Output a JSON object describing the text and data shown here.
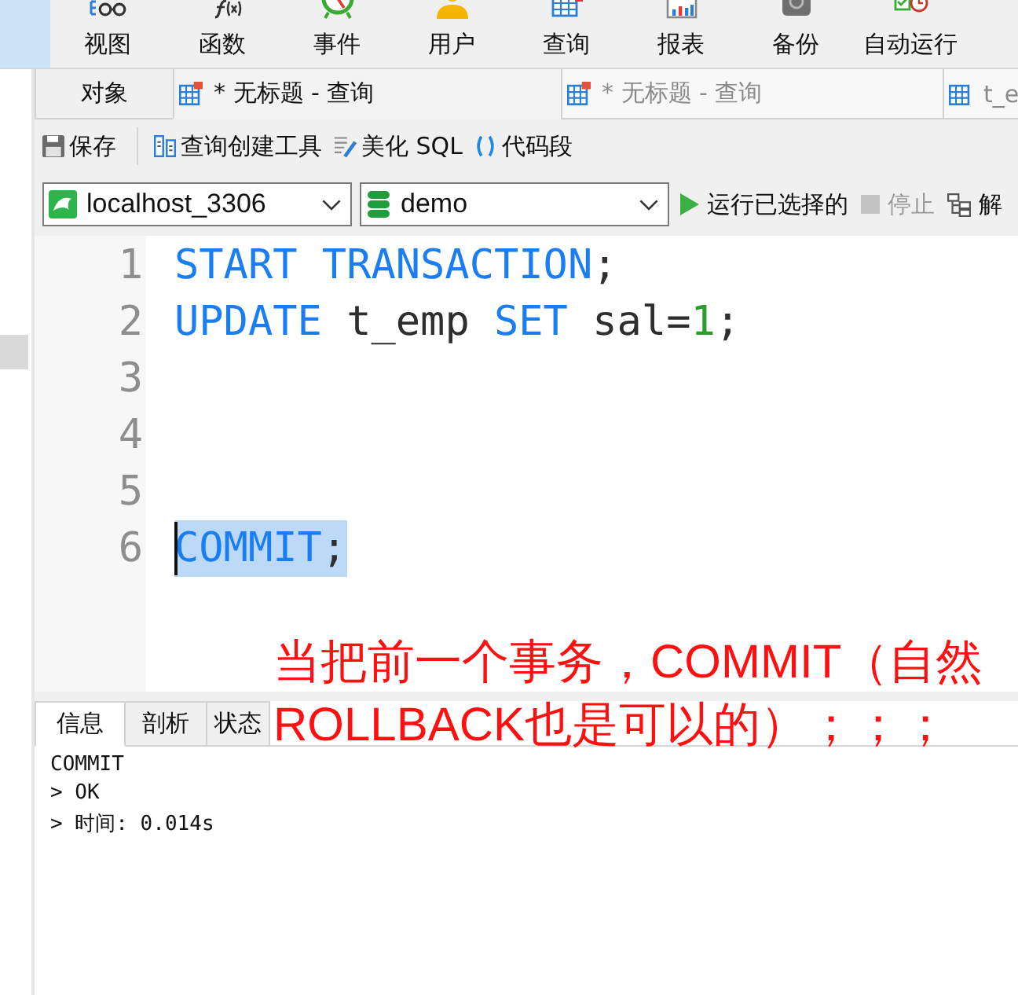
{
  "toolbar": {
    "items": [
      {
        "selected": true
      },
      {
        "label": "视图",
        "selected": false
      },
      {
        "label": "函数",
        "selected": false
      },
      {
        "label": "事件",
        "selected": false
      },
      {
        "label": "用户",
        "selected": false
      },
      {
        "label": "查询",
        "selected": false
      },
      {
        "label": "报表",
        "selected": false
      },
      {
        "label": "备份",
        "selected": false
      },
      {
        "label": "自动运行",
        "selected": false
      }
    ]
  },
  "object_tabs": [
    {
      "kind": "objects",
      "label": "对象",
      "selected": false
    },
    {
      "kind": "query",
      "label": "* 无标题 - 查询",
      "selected": true
    },
    {
      "kind": "query",
      "label": "* 无标题 - 查询",
      "selected": false
    },
    {
      "kind": "table",
      "label": "t_e",
      "selected": false
    }
  ],
  "editor_toolbar": [
    {
      "label": "保存"
    },
    {
      "label": "查询创建工具"
    },
    {
      "label": "美化 SQL"
    },
    {
      "label": "代码段"
    }
  ],
  "connection": {
    "value": "localhost_3306"
  },
  "database": {
    "value": "demo"
  },
  "actions": [
    {
      "label": "运行已选择的",
      "disabled": false
    },
    {
      "label": "停止",
      "disabled": true
    },
    {
      "label": "解",
      "disabled": false
    }
  ],
  "editor": {
    "lines": [
      {
        "number": "1",
        "selected": false,
        "caret": false,
        "tokens": [
          {
            "kind": "keyword",
            "text": "START TRANSACTION"
          },
          {
            "kind": "plain",
            "text": ";"
          }
        ]
      },
      {
        "number": "2",
        "selected": false,
        "caret": false,
        "tokens": [
          {
            "kind": "keyword",
            "text": "UPDATE"
          },
          {
            "kind": "plain",
            "text": " t_emp "
          },
          {
            "kind": "keyword",
            "text": "SET"
          },
          {
            "kind": "plain",
            "text": " sal="
          },
          {
            "kind": "number",
            "text": "1"
          },
          {
            "kind": "plain",
            "text": ";"
          }
        ]
      },
      {
        "number": "3",
        "selected": false,
        "caret": false
      },
      {
        "number": "4",
        "selected": false,
        "caret": false
      },
      {
        "number": "5",
        "selected": false,
        "caret": false
      },
      {
        "number": "6",
        "selected": true,
        "caret": true,
        "tokens": [
          {
            "kind": "keyword",
            "text": "COMMIT"
          },
          {
            "kind": "plain",
            "text": ";"
          }
        ]
      }
    ]
  },
  "annotation": {
    "lines": [
      "当把前一个事务，COMMIT（自然",
      "ROLLBACK也是可以的）；；；"
    ]
  },
  "result_tabs": [
    {
      "label": "信息",
      "selected": true
    },
    {
      "label": "剖析",
      "selected": false
    },
    {
      "label": "状态",
      "selected": false
    }
  ],
  "messages": [
    "COMMIT",
    "> OK",
    "> 时间: 0.014s"
  ]
}
